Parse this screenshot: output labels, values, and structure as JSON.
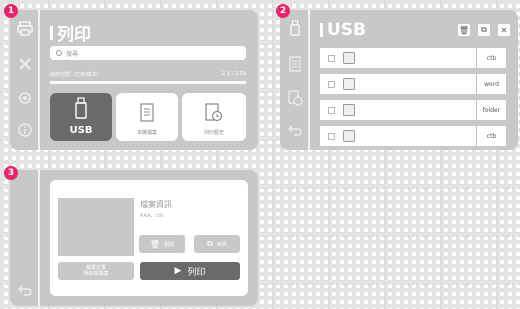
{
  "badges": [
    "1",
    "2",
    "3"
  ],
  "screen1": {
    "title": "列印",
    "search_placeholder": "搜尋",
    "storage_label": "儲存空間（已用/總共）",
    "storage_value": "2.1 / 3.50",
    "storage_fraction": 0.6,
    "tiles": [
      {
        "label": "USB",
        "selected": true
      },
      {
        "label": "本機檔案",
        "selected": false
      },
      {
        "label": "列印歷史",
        "selected": false
      }
    ]
  },
  "screen2": {
    "title": "USB",
    "rows": [
      {
        "ext": "ctb",
        "kind": "file"
      },
      {
        "ext": "word",
        "kind": "file"
      },
      {
        "ext": "folder",
        "kind": "folder"
      },
      {
        "ext": "ctb",
        "kind": "file"
      }
    ]
  },
  "screen3": {
    "info_title": "檔案資訊",
    "file_name": "AAA，ctb",
    "delete_label": "刪除",
    "copy_label": "拷貝",
    "location_line1": "檔案位置",
    "location_line2": "現存檔檔案",
    "print_label": "列印"
  }
}
